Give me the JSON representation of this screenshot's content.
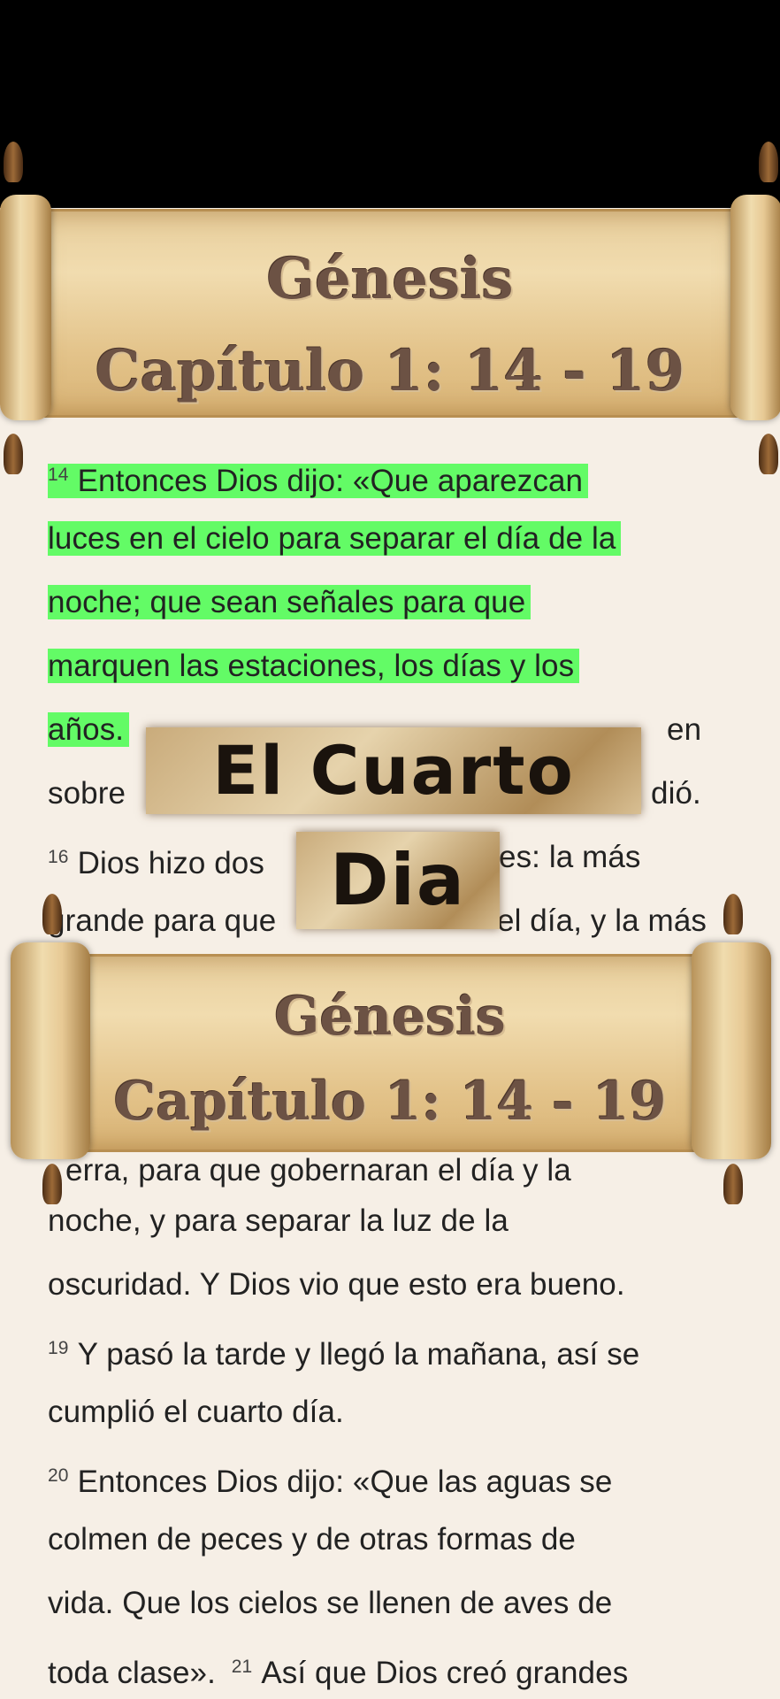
{
  "scroll_top": {
    "title1": "Génesis",
    "title2": "Capítulo 1: 14 - 19"
  },
  "scroll_bottom": {
    "title1": "Génesis",
    "title2": "Capítulo 1: 14 - 19"
  },
  "stamp": {
    "line1": "El Cuarto",
    "line2": "Dia"
  },
  "highlight_color": "#63fb66",
  "verses": {
    "l1_num": "14",
    "l1": "Entonces Dios dijo: «Que aparezcan",
    "l2": "luces en el cielo para separar el día de la",
    "l3": "noche; que sean señales para que",
    "l4": "marquen las estaciones, los días y los",
    "l5a": "años.",
    "l5b": "en",
    "l6a": "sobre",
    "l6b": "dió.",
    "l7_num": "16",
    "l7a": "Dios hizo dos",
    "l7b": "es: la más",
    "l8a": "grande para que",
    "l8b": "el día, y la más",
    "l9": "erra, para que gobernaran el día y la",
    "l10": "noche, y para separar la luz de la",
    "l11": "oscuridad. Y Dios vio que esto era bueno.",
    "l12_num": "19",
    "l12": "Y pasó la tarde y llegó la mañana, así se",
    "l13": "cumplió el cuarto día.",
    "l14_num": "20",
    "l14": "Entonces Dios dijo: «Que las aguas se",
    "l15": "colmen de peces y de otras formas de",
    "l16": "vida. Que los cielos se llenen de aves de",
    "l17a": "toda clase».",
    "l17_num": "21",
    "l17b": "Así que Dios creó grandes"
  }
}
